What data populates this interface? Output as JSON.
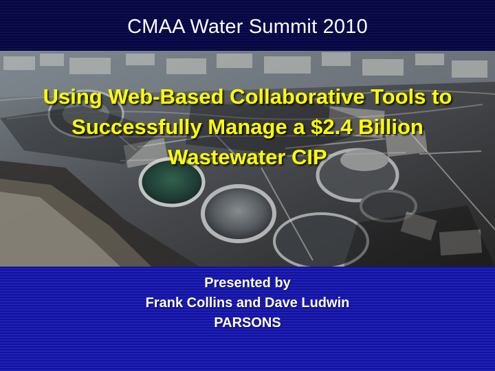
{
  "slide": {
    "header": "CMAA  Water Summit 2010",
    "title_lines": [
      "Using Web-Based Collaborative Tools to",
      "Successfully Manage a $2.4 Billion",
      "Wastewater CIP"
    ],
    "presenters": [
      "Presented by",
      "Frank Collins and Dave Ludwin",
      "PARSONS"
    ]
  },
  "colors": {
    "header_background": "#0d0d55",
    "title_text": "#ffff00",
    "bottom_background": "#1f21b8",
    "text": "#ffffff"
  }
}
